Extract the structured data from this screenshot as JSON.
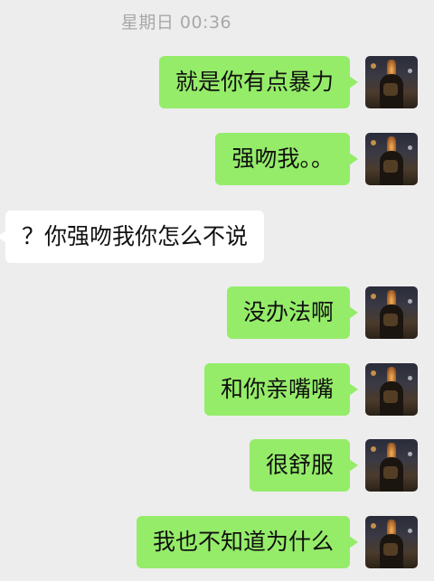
{
  "header": {
    "timestamp": "星期日 00:36"
  },
  "messages": [
    {
      "sender": "me",
      "text": "就是你有点暴力"
    },
    {
      "sender": "me",
      "text": "强吻我。。"
    },
    {
      "sender": "other",
      "text": "？你强吻我你怎么不说"
    },
    {
      "sender": "me",
      "text": "没办法啊"
    },
    {
      "sender": "me",
      "text": "和你亲嘴嘴"
    },
    {
      "sender": "me",
      "text": "很舒服"
    },
    {
      "sender": "me",
      "text": "我也不知道为什么"
    }
  ],
  "colors": {
    "background": "#ededed",
    "my_bubble": "#95ec69",
    "other_bubble": "#ffffff",
    "timestamp_text": "#a8a8a8"
  }
}
